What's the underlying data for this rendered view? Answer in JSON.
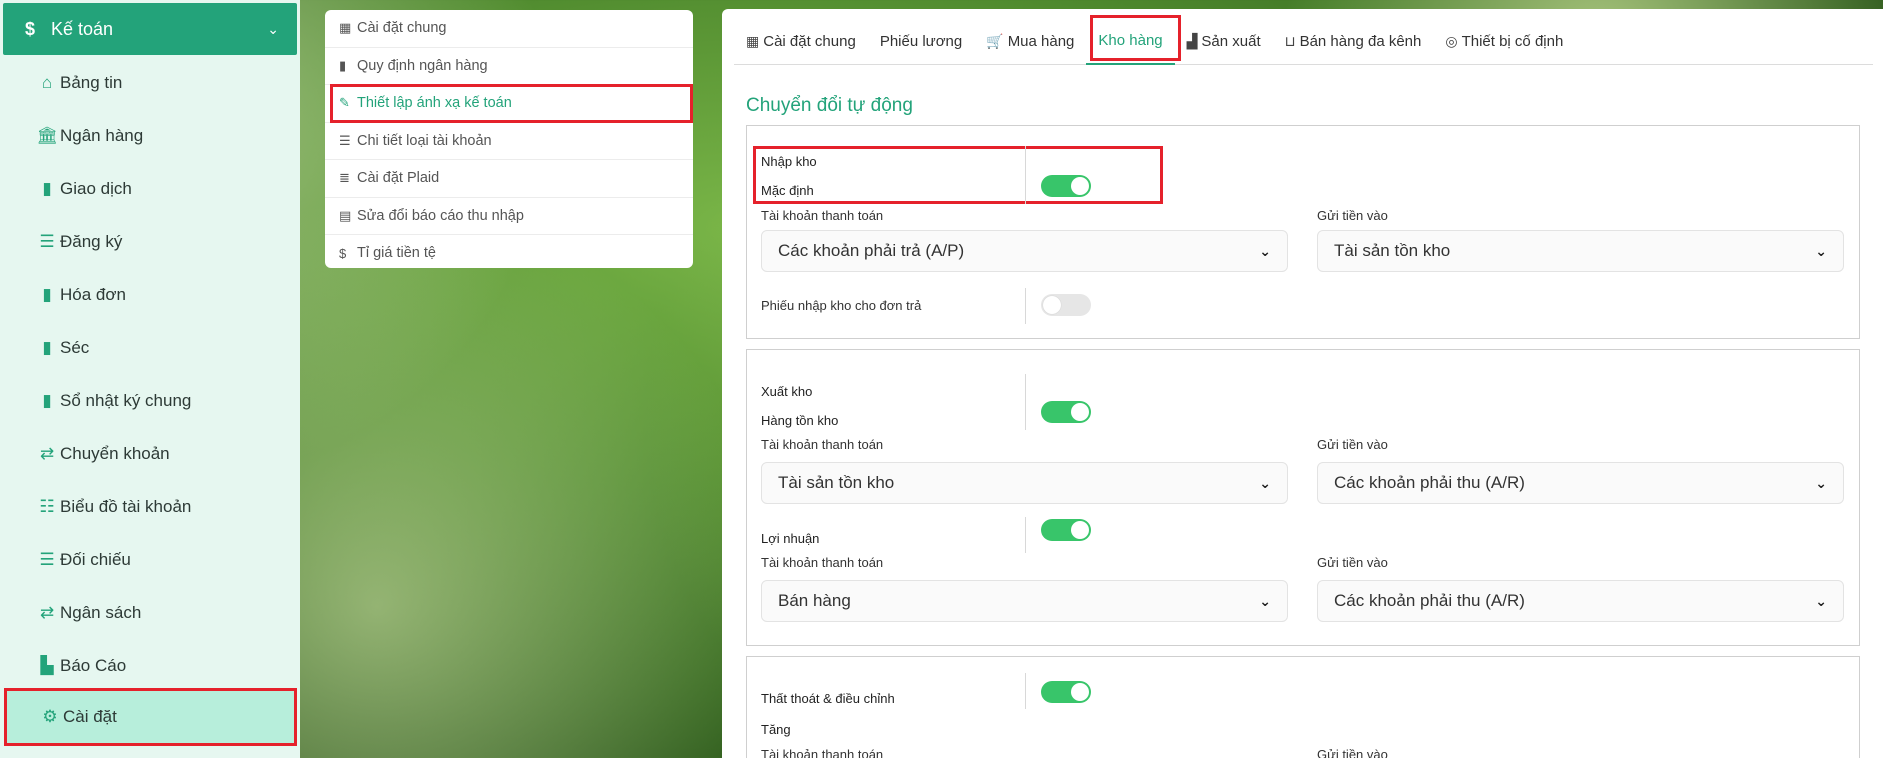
{
  "sidebar": {
    "header": {
      "icon": "dollar-icon",
      "label": "Kế toán",
      "chevron": "chevron-down-icon"
    },
    "items": [
      {
        "label": "Bảng tin",
        "icon": "home-icon",
        "glyph": "⌂"
      },
      {
        "label": "Ngân hàng",
        "icon": "bank-icon",
        "glyph": "🏛"
      },
      {
        "label": "Giao dịch",
        "icon": "file-icon",
        "glyph": "▮"
      },
      {
        "label": "Đăng ký",
        "icon": "list-icon",
        "glyph": "☰"
      },
      {
        "label": "Hóa đơn",
        "icon": "book-icon",
        "glyph": "▮"
      },
      {
        "label": "Séc",
        "icon": "book-icon",
        "glyph": "▮"
      },
      {
        "label": "Sổ nhật ký chung",
        "icon": "book-icon",
        "glyph": "▮"
      },
      {
        "label": "Chuyển khoản",
        "icon": "exchange-icon",
        "glyph": "⇄"
      },
      {
        "label": "Biểu đồ tài khoản",
        "icon": "ordered-list-icon",
        "glyph": "☷"
      },
      {
        "label": "Đối chiếu",
        "icon": "sliders-icon",
        "glyph": "☰"
      },
      {
        "label": "Ngân sách",
        "icon": "exchange-icon",
        "glyph": "⇄"
      },
      {
        "label": "Báo Cáo",
        "icon": "area-chart-icon",
        "glyph": "▙"
      },
      {
        "label": "Cài đặt",
        "icon": "gear-icon",
        "glyph": "⚙"
      }
    ]
  },
  "submenu": {
    "items": [
      {
        "label": "Cài đặt chung",
        "glyph": "▦"
      },
      {
        "label": "Quy định ngân hàng",
        "glyph": "▮"
      },
      {
        "label": "Thiết lập ánh xạ kế toán",
        "glyph": "✎"
      },
      {
        "label": "Chi tiết loại tài khoản",
        "glyph": "☰"
      },
      {
        "label": "Cài đặt Plaid",
        "glyph": "≣"
      },
      {
        "label": "Sửa đổi báo cáo thu nhập",
        "glyph": "▤"
      },
      {
        "label": "Tỉ giá tiền tệ",
        "glyph": "$"
      }
    ]
  },
  "tabs": [
    {
      "label": "Cài đặt chung",
      "glyph": "▦"
    },
    {
      "label": "Phiếu lương",
      "glyph": ""
    },
    {
      "label": "Mua hàng",
      "glyph": "🛒"
    },
    {
      "label": "Kho hàng",
      "glyph": ""
    },
    {
      "label": "Sản xuất",
      "glyph": "▟"
    },
    {
      "label": "Bán hàng đa kênh",
      "glyph": "⊔"
    },
    {
      "label": "Thiết bị cố định",
      "glyph": "◎"
    }
  ],
  "main": {
    "section_title": "Chuyển đổi tự động",
    "import": {
      "title": "Nhập kho",
      "default_label": "Mặc định",
      "default_on": true,
      "payment_label": "Tài khoản thanh toán",
      "payment_value": "Các khoản phải trả (A/P)",
      "deposit_label": "Gửi tiền vào",
      "deposit_value": "Tài sản tồn kho",
      "return_label": "Phiếu nhập kho cho đơn trả",
      "return_on": false
    },
    "export": {
      "title": "Xuất kho",
      "inventory_label": "Hàng tồn kho",
      "inventory_on": true,
      "payment_label": "Tài khoản thanh toán",
      "payment_value": "Tài sản tồn kho",
      "deposit_label": "Gửi tiền vào",
      "deposit_value": "Các khoản phải thu (A/R)",
      "profit_label": "Lợi nhuận",
      "profit_on": true,
      "profit_payment_label": "Tài khoản thanh toán",
      "profit_payment_value": "Bán hàng",
      "profit_deposit_label": "Gửi tiền vào",
      "profit_deposit_value": "Các khoản phải thu (A/R)"
    },
    "loss": {
      "title": "Thất thoát & điều chỉnh",
      "on": true,
      "increase_label": "Tăng",
      "payment_label": "Tài khoản thanh toán",
      "deposit_label": "Gửi tiền vào"
    }
  },
  "colors": {
    "accent": "#23a37a",
    "toggle_on": "#38c56a",
    "highlight": "#e5212b"
  }
}
